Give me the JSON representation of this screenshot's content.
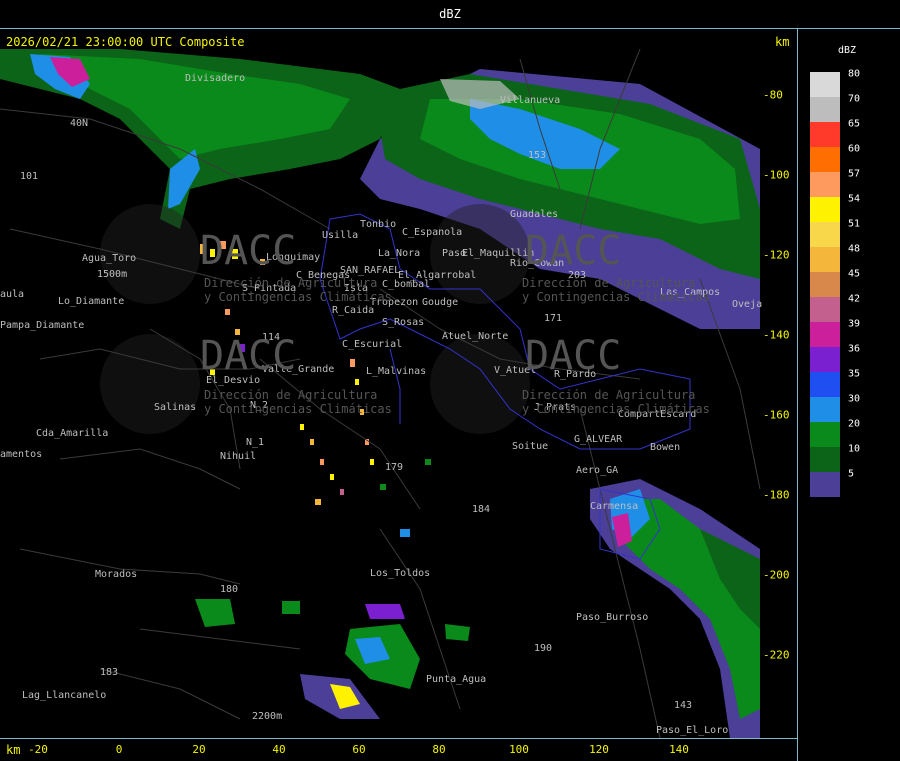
{
  "title": "dBZ",
  "header_info": "2026/02/21 23:00:00 UTC Composite",
  "km_unit": "km",
  "x_axis_ticks": [
    "-20",
    "0",
    "20",
    "40",
    "60",
    "80",
    "100",
    "120",
    "140"
  ],
  "y_axis_ticks": [
    "-80",
    "-100",
    "-120",
    "-140",
    "-160",
    "-180",
    "-200",
    "-220"
  ],
  "legend": {
    "title": "dBZ",
    "entries": [
      {
        "label": "80",
        "color": "#d9d9d9"
      },
      {
        "label": "70",
        "color": "#bdbdbd"
      },
      {
        "label": "65",
        "color": "#ff3a2a"
      },
      {
        "label": "60",
        "color": "#ff6e00"
      },
      {
        "label": "57",
        "color": "#ff9a5e"
      },
      {
        "label": "54",
        "color": "#fff200"
      },
      {
        "label": "51",
        "color": "#f8d74a"
      },
      {
        "label": "48",
        "color": "#f4b73c"
      },
      {
        "label": "45",
        "color": "#d8884a"
      },
      {
        "label": "42",
        "color": "#c4608e"
      },
      {
        "label": "39",
        "color": "#cc1f9c"
      },
      {
        "label": "36",
        "color": "#7a20d0"
      },
      {
        "label": "35",
        "color": "#1f4ff0"
      },
      {
        "label": "30",
        "color": "#1f8ee6"
      },
      {
        "label": "20",
        "color": "#0a8a1a"
      },
      {
        "label": "10",
        "color": "#0b6418"
      },
      {
        "label": "5",
        "color": "#4b3f98"
      }
    ]
  },
  "place_labels": [
    "Divisadero",
    "40N",
    "101",
    "Agua_Toro",
    "1500m",
    "Lo_Diamante",
    "Pampa_Diamante",
    "aula",
    "Villanueva",
    "153",
    "Tonbio",
    "Usilla",
    "C_Espanola",
    "La_Nora",
    "Paso",
    "El_Maquillin",
    "Lonquimay",
    "Rio_Cowan",
    "Guadales",
    "C_Benegas",
    "SAN_RAFAEL",
    "El_Algarrobal",
    "C_bombal",
    "S_Pintada",
    "Isla",
    "Tropezon",
    "Goudge",
    "R_Caida",
    "S_Rosas",
    "Atuel_Norte",
    "171",
    "C_Escurial",
    "V_Atuel",
    "R_Pardo",
    "Valle_Grande",
    "L_Malvinas",
    "El_Desvio",
    "Salinas",
    "N_2",
    "N_1",
    "Nihuil",
    "J_Prats",
    "CompartEscard",
    "G_ALVEAR",
    "Soitue",
    "Bowen",
    "Cda_Amarilla",
    "amentos",
    "Aero_GA",
    "Carmensa",
    "Los_Toldos",
    "179",
    "184",
    "Morados",
    "180",
    "183",
    "Lag_Llancanelo",
    "Punta_Agua",
    "190",
    "Paso_Burroso",
    "143",
    "Paso_El_Loro",
    "2200m",
    "Las_Campos",
    "Oveja",
    "203",
    "114"
  ],
  "watermark": {
    "brand": "DACC",
    "line1": "Dirección de Agricultura",
    "line2": "y Contingencias Climáticas"
  },
  "radar_echoes": [
    {
      "region": "north-east-band",
      "dbz_range": "5-36"
    },
    {
      "region": "north-west-corner",
      "dbz_range": "30-42"
    },
    {
      "region": "south-east-band",
      "dbz_range": "5-39"
    },
    {
      "region": "central-scattered-cells",
      "dbz_range": "20-57"
    },
    {
      "region": "southern-cells",
      "dbz_range": "5-54"
    }
  ]
}
